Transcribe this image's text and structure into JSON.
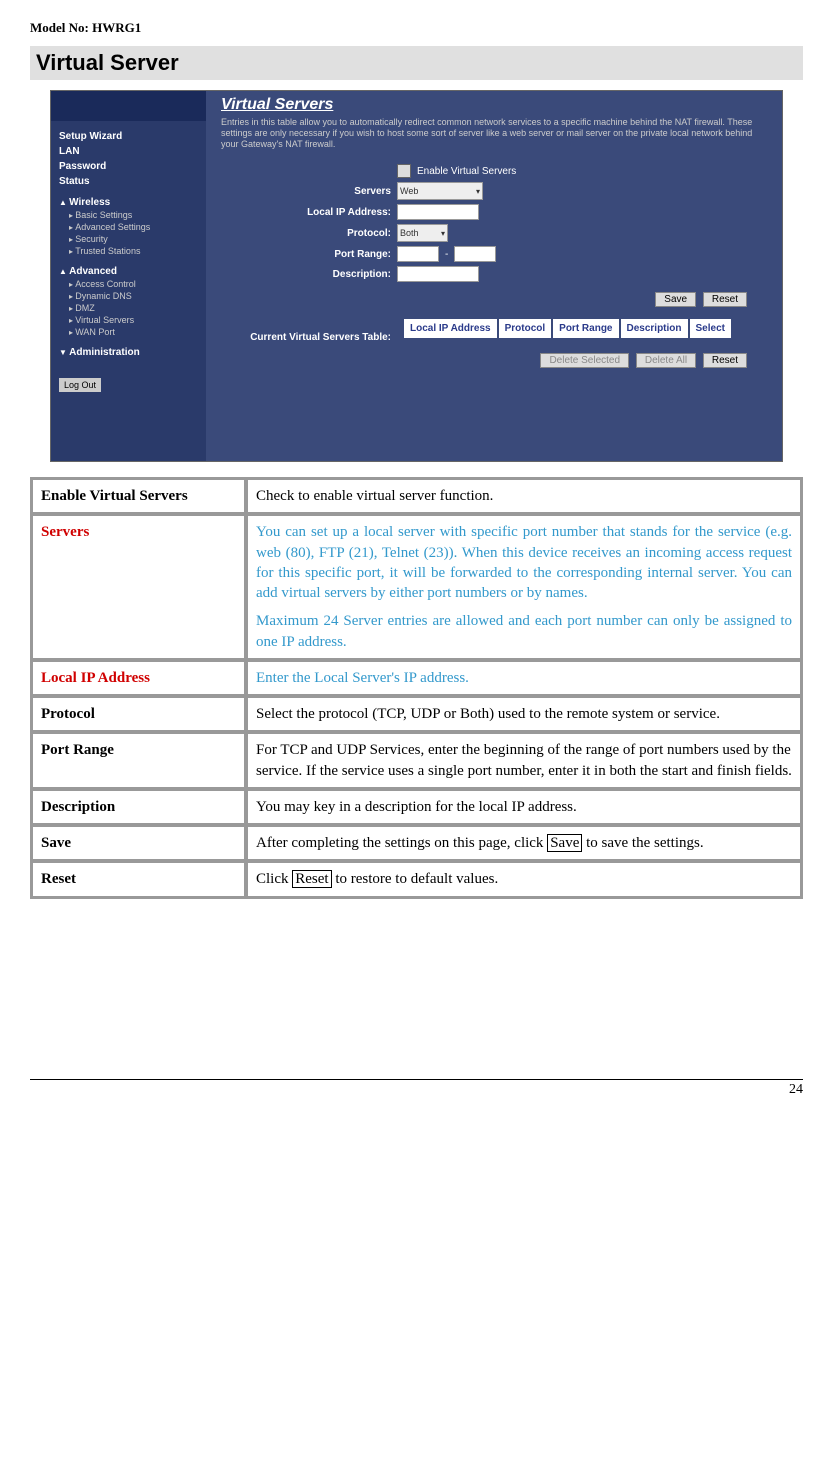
{
  "header": {
    "model_no": "Model No: HWRG1"
  },
  "section": {
    "title": "Virtual Server"
  },
  "screenshot": {
    "nav": {
      "setup_wizard": "Setup Wizard",
      "lan": "LAN",
      "password": "Password",
      "status": "Status",
      "wireless": "Wireless",
      "wireless_items": {
        "basic": "Basic Settings",
        "advanced": "Advanced Settings",
        "security": "Security",
        "trusted": "Trusted Stations"
      },
      "advanced": "Advanced",
      "advanced_items": {
        "access": "Access Control",
        "ddns": "Dynamic DNS",
        "dmz": "DMZ",
        "vservers": "Virtual Servers",
        "wan": "WAN Port"
      },
      "administration": "Administration",
      "logout": "Log Out"
    },
    "main": {
      "heading": "Virtual Servers",
      "desc": "Entries in this table allow you to automatically redirect common network services to a specific machine behind the NAT firewall. These settings are only necessary if you wish to host some sort of server like a web server or mail server on the private local network behind your Gateway's NAT firewall.",
      "enable_label": "Enable Virtual Servers",
      "form": {
        "servers_label": "Servers",
        "servers_value": "Web",
        "local_ip_label": "Local IP Address:",
        "protocol_label": "Protocol:",
        "protocol_value": "Both",
        "port_range_label": "Port Range:",
        "port_dash": "-",
        "description_label": "Description:"
      },
      "buttons": {
        "save": "Save",
        "reset": "Reset",
        "delete_selected": "Delete Selected",
        "delete_all": "Delete All"
      },
      "table_label": "Current Virtual Servers Table:",
      "table_headers": {
        "local_ip": "Local IP Address",
        "protocol": "Protocol",
        "port_range": "Port Range",
        "description": "Description",
        "select": "Select"
      }
    }
  },
  "desc_table": {
    "rows": [
      {
        "label": "Enable Virtual Servers",
        "text": "Check to enable virtual server function."
      },
      {
        "label": "Servers",
        "label_red": true,
        "text_blue": true,
        "p1": "You can set up a local server with specific port number that stands for the service (e.g. web (80), FTP (21), Telnet (23)). When this device receives an incoming access request for this specific port, it will be forwarded to the corresponding internal server. You can add virtual servers by either port numbers or by names.",
        "p2": "Maximum 24 Server entries are allowed and each port number can only be assigned to one IP address."
      },
      {
        "label": "Local IP Address",
        "label_red": true,
        "text_blue": true,
        "text": "Enter the Local Server's IP address."
      },
      {
        "label": "Protocol",
        "text": "Select the protocol (TCP, UDP or Both) used to the remote system or service."
      },
      {
        "label": "Port Range",
        "text": "For TCP and UDP Services, enter the beginning of the range of port numbers used by the service. If the service uses a single port number, enter it in both the start and finish fields."
      },
      {
        "label": "Description",
        "text": "You may key in a description for the local IP address."
      },
      {
        "label": "Save",
        "pre": "After completing the settings on this page, click ",
        "boxed": "Save",
        "post": " to save the settings."
      },
      {
        "label": "Reset",
        "pre": "Click ",
        "boxed": "Reset",
        "post": " to restore to default values."
      }
    ]
  },
  "footer": {
    "page_no": "24"
  }
}
